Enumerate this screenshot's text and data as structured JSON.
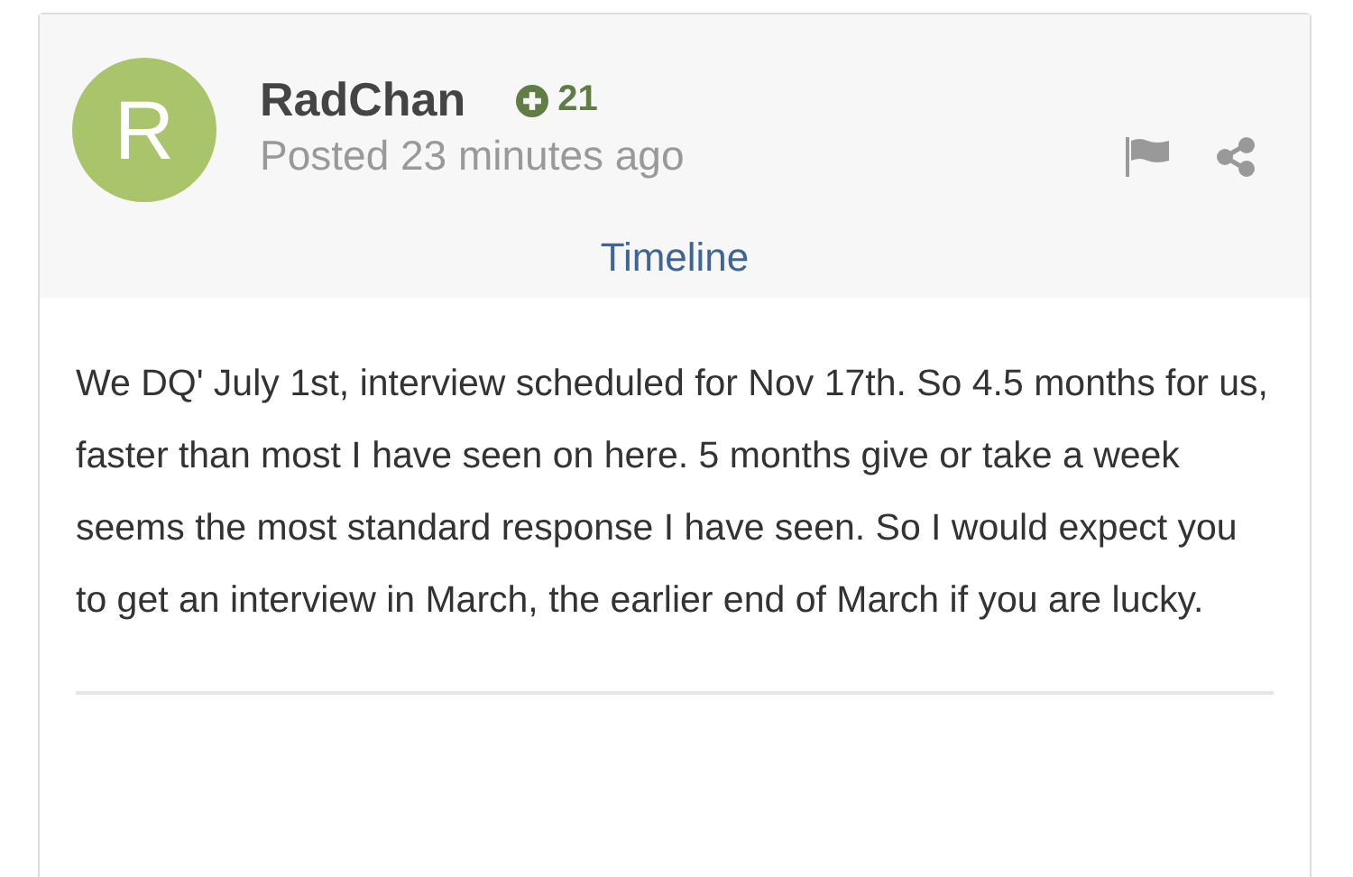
{
  "post": {
    "avatar_letter": "R",
    "author": "RadChan",
    "reputation": "21",
    "posted": "Posted 23 minutes ago",
    "timeline_link": "Timeline",
    "body": "We DQ' July 1st, interview scheduled for Nov 17th. So 4.5 months for us, faster than most I have seen on here. 5 months give or take a week seems the most standard response I have seen. So I would expect you to get an interview in March, the earlier end of March if you are lucky."
  }
}
